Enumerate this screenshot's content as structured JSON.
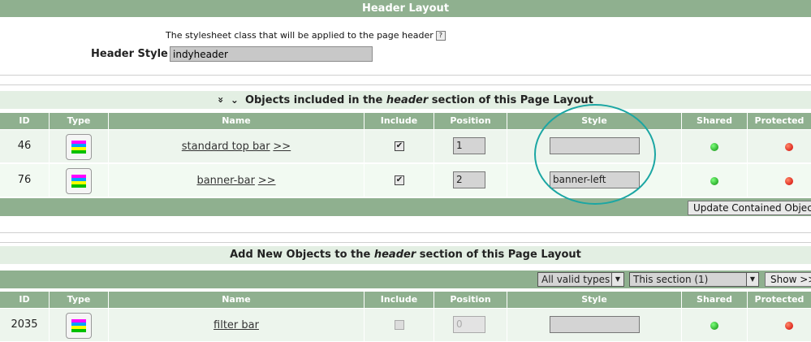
{
  "header_layout": {
    "title": "Header Layout",
    "description": "The stylesheet class that will be applied to the page header",
    "help_glyph": "?",
    "style_label": "Header Style",
    "style_value": "indyheader"
  },
  "contained": {
    "heading_pre": "Objects included in the ",
    "heading_em": "header",
    "heading_post": " section of this Page Layout",
    "collapse_glyph": "»",
    "expand_glyph": "⌄",
    "columns": [
      "ID",
      "Type",
      "Name",
      "Include",
      "Position",
      "Style",
      "Shared",
      "Protected"
    ],
    "rows": [
      {
        "id": "46",
        "name": "standard top bar",
        "link": ">>",
        "include": true,
        "position": "1",
        "style": "",
        "shared": "green",
        "protected": "red"
      },
      {
        "id": "76",
        "name": "banner-bar",
        "link": ">>",
        "include": true,
        "position": "2",
        "style": "banner-left",
        "shared": "green",
        "protected": "red"
      }
    ],
    "update_button": "Update Contained Objects"
  },
  "add_new": {
    "heading_pre": "Add New Objects to the ",
    "heading_em": "header",
    "heading_post": " section of this Page Layout",
    "filter_type": "All valid types",
    "filter_section": "This section (1)",
    "show_button": "Show >>",
    "columns": [
      "ID",
      "Type",
      "Name",
      "Include",
      "Position",
      "Style",
      "Shared",
      "Protected"
    ],
    "rows": [
      {
        "id": "2035",
        "name": "filter bar",
        "include": false,
        "position": "0",
        "style": "",
        "shared": "green",
        "protected": "red"
      }
    ]
  },
  "colors": {
    "bar": "#8fb08f",
    "annotation": "#1ba6a3"
  }
}
